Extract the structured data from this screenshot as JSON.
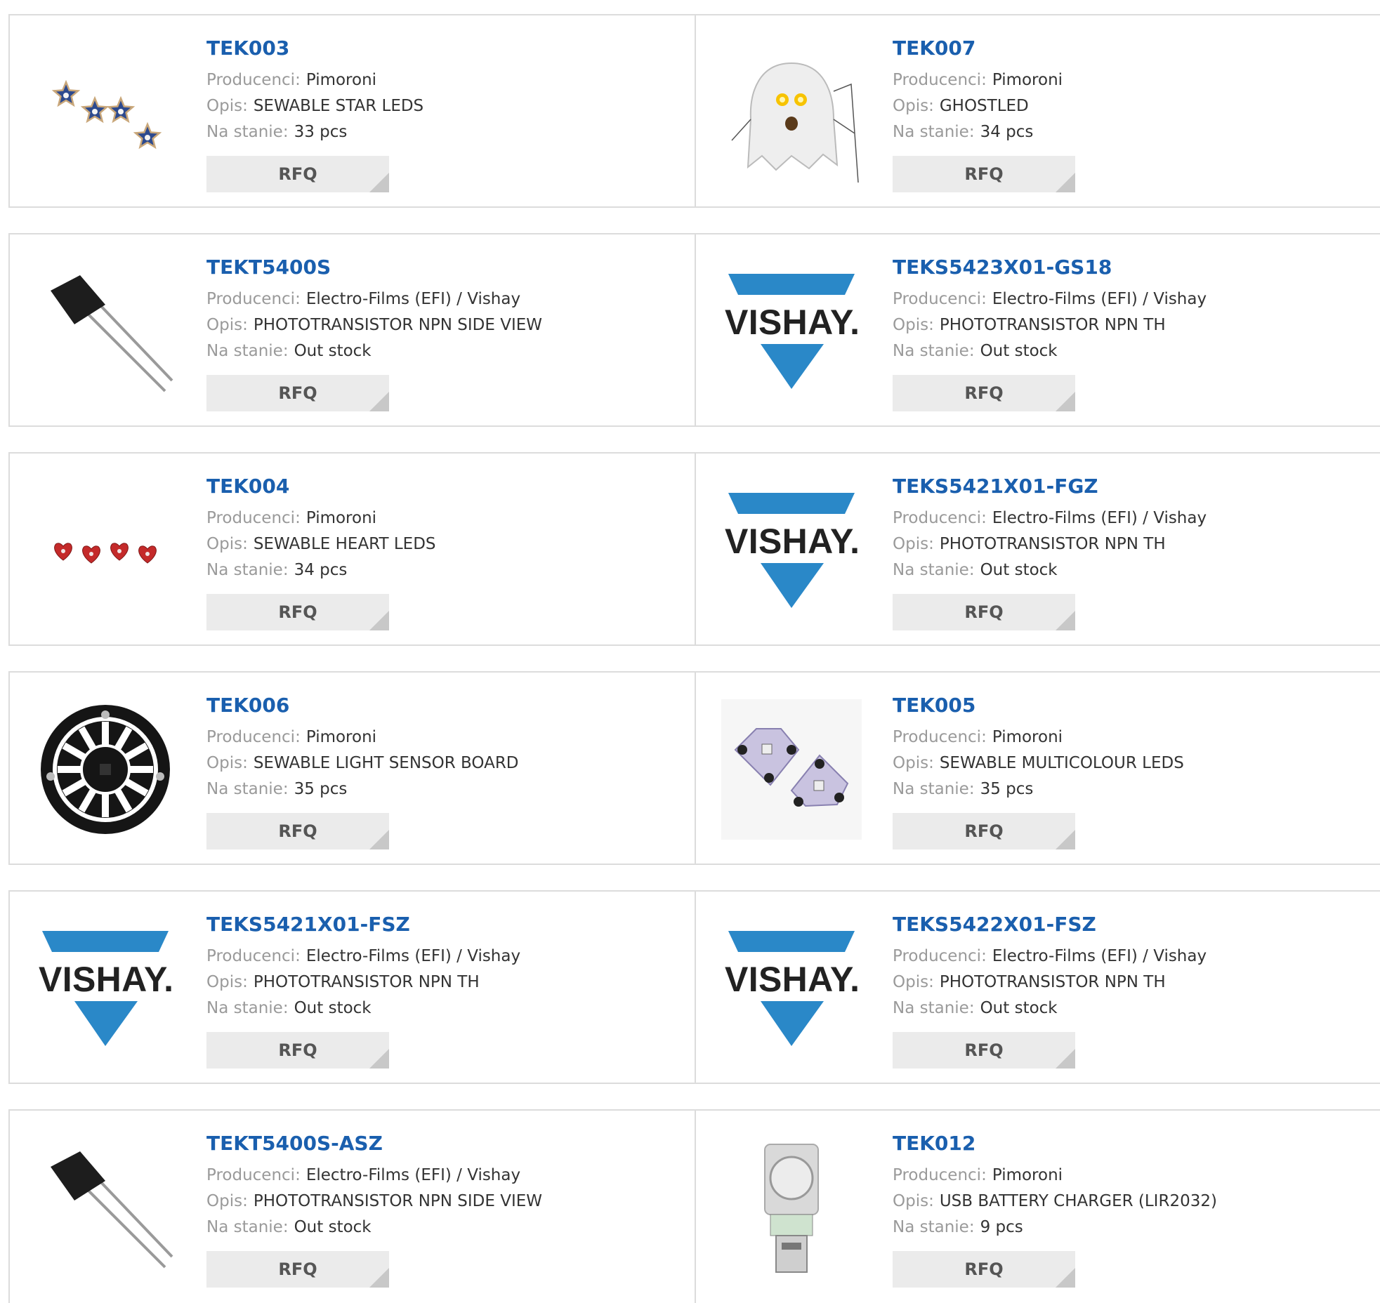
{
  "labels": {
    "manufacturer": "Producenci:",
    "description": "Opis:",
    "stock": "Na stanie:"
  },
  "rfq_label": "RFQ",
  "colors": {
    "link": "#1a5fae",
    "vishay_blue": "#2a88c8",
    "button_bg": "#ebebeb"
  },
  "products": [
    {
      "part": "TEK003",
      "manufacturer": "Pimoroni",
      "description": "SEWABLE STAR LEDS",
      "stock": "33 pcs",
      "image": "star-leds"
    },
    {
      "part": "TEK007",
      "manufacturer": "Pimoroni",
      "description": "GHOSTLED",
      "stock": "34 pcs",
      "image": "ghost-led"
    },
    {
      "part": "TEKT5400S",
      "manufacturer": "Electro-Films (EFI) / Vishay",
      "description": "PHOTOTRANSISTOR NPN SIDE VIEW",
      "stock": "Out stock",
      "image": "phototransistor"
    },
    {
      "part": "TEKS5423X01-GS18",
      "manufacturer": "Electro-Films (EFI) / Vishay",
      "description": "PHOTOTRANSISTOR NPN TH",
      "stock": "Out stock",
      "image": "vishay-logo",
      "logo_text": "VISHAY."
    },
    {
      "part": "TEK004",
      "manufacturer": "Pimoroni",
      "description": "SEWABLE HEART LEDS",
      "stock": "34 pcs",
      "image": "heart-leds"
    },
    {
      "part": "TEKS5421X01-FGZ",
      "manufacturer": "Electro-Films (EFI) / Vishay",
      "description": "PHOTOTRANSISTOR NPN TH",
      "stock": "Out stock",
      "image": "vishay-logo",
      "logo_text": "VISHAY."
    },
    {
      "part": "TEK006",
      "manufacturer": "Pimoroni",
      "description": "SEWABLE LIGHT SENSOR BOARD",
      "stock": "35 pcs",
      "image": "light-sensor-board"
    },
    {
      "part": "TEK005",
      "manufacturer": "Pimoroni",
      "description": "SEWABLE MULTICOLOUR LEDS",
      "stock": "35 pcs",
      "image": "multicolour-leds"
    },
    {
      "part": "TEKS5421X01-FSZ",
      "manufacturer": "Electro-Films (EFI) / Vishay",
      "description": "PHOTOTRANSISTOR NPN TH",
      "stock": "Out stock",
      "image": "vishay-logo",
      "logo_text": "VISHAY."
    },
    {
      "part": "TEKS5422X01-FSZ",
      "manufacturer": "Electro-Films (EFI) / Vishay",
      "description": "PHOTOTRANSISTOR NPN TH",
      "stock": "Out stock",
      "image": "vishay-logo",
      "logo_text": "VISHAY."
    },
    {
      "part": "TEKT5400S-ASZ",
      "manufacturer": "Electro-Films (EFI) / Vishay",
      "description": "PHOTOTRANSISTOR NPN SIDE VIEW",
      "stock": "Out stock",
      "image": "phototransistor"
    },
    {
      "part": "TEK012",
      "manufacturer": "Pimoroni",
      "description": "USB BATTERY CHARGER (LIR2032)",
      "stock": "9 pcs",
      "image": "usb-battery-charger"
    }
  ]
}
